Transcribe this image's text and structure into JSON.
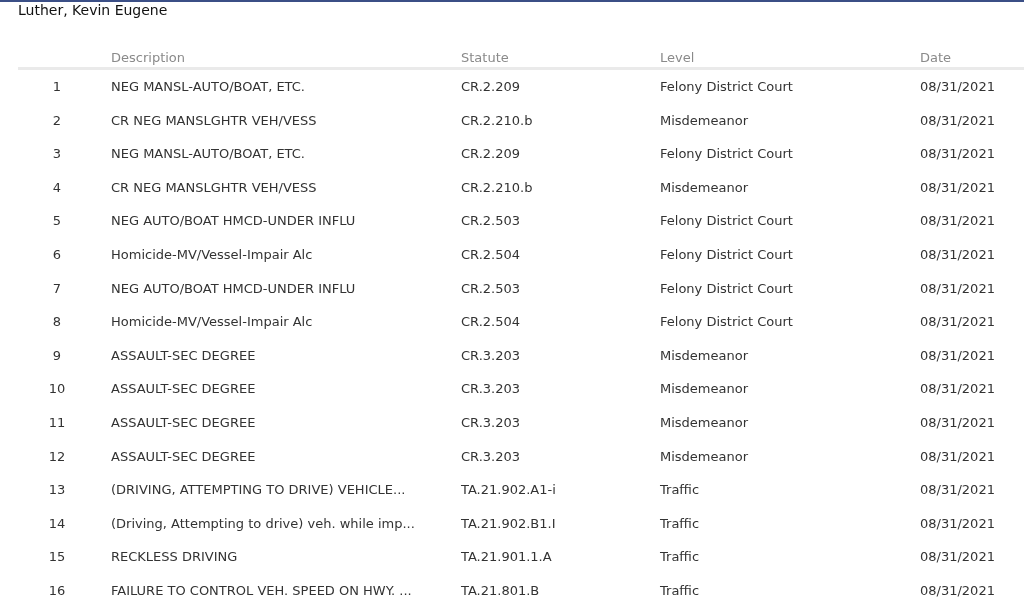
{
  "person_name": "Luther, Kevin Eugene",
  "table": {
    "columns": [
      "Description",
      "Statute",
      "Level",
      "Date"
    ],
    "rows": [
      {
        "number": "1",
        "description": "NEG MANSL-AUTO/BOAT, ETC.",
        "statute": "CR.2.209",
        "level": "Felony District Court",
        "date": "08/31/2021"
      },
      {
        "number": "2",
        "description": "CR NEG MANSLGHTR VEH/VESS",
        "statute": "CR.2.210.b",
        "level": "Misdemeanor",
        "date": "08/31/2021"
      },
      {
        "number": "3",
        "description": "NEG MANSL-AUTO/BOAT, ETC.",
        "statute": "CR.2.209",
        "level": "Felony District Court",
        "date": "08/31/2021"
      },
      {
        "number": "4",
        "description": "CR NEG MANSLGHTR VEH/VESS",
        "statute": "CR.2.210.b",
        "level": "Misdemeanor",
        "date": "08/31/2021"
      },
      {
        "number": "5",
        "description": "NEG AUTO/BOAT HMCD-UNDER INFLU",
        "statute": "CR.2.503",
        "level": "Felony District Court",
        "date": "08/31/2021"
      },
      {
        "number": "6",
        "description": "Homicide-MV/Vessel-Impair Alc",
        "statute": "CR.2.504",
        "level": "Felony District Court",
        "date": "08/31/2021"
      },
      {
        "number": "7",
        "description": "NEG AUTO/BOAT HMCD-UNDER INFLU",
        "statute": "CR.2.503",
        "level": "Felony District Court",
        "date": "08/31/2021"
      },
      {
        "number": "8",
        "description": "Homicide-MV/Vessel-Impair Alc",
        "statute": "CR.2.504",
        "level": "Felony District Court",
        "date": "08/31/2021"
      },
      {
        "number": "9",
        "description": "ASSAULT-SEC DEGREE",
        "statute": "CR.3.203",
        "level": "Misdemeanor",
        "date": "08/31/2021"
      },
      {
        "number": "10",
        "description": "ASSAULT-SEC DEGREE",
        "statute": "CR.3.203",
        "level": "Misdemeanor",
        "date": "08/31/2021"
      },
      {
        "number": "11",
        "description": "ASSAULT-SEC DEGREE",
        "statute": "CR.3.203",
        "level": "Misdemeanor",
        "date": "08/31/2021"
      },
      {
        "number": "12",
        "description": "ASSAULT-SEC DEGREE",
        "statute": "CR.3.203",
        "level": "Misdemeanor",
        "date": "08/31/2021"
      },
      {
        "number": "13",
        "description": "(DRIVING, ATTEMPTING TO DRIVE) VEHICLE...",
        "statute": "TA.21.902.A1-i",
        "level": "Traffic",
        "date": "08/31/2021"
      },
      {
        "number": "14",
        "description": "(Driving, Attempting to drive) veh. while imp...",
        "statute": "TA.21.902.B1.I",
        "level": "Traffic",
        "date": "08/31/2021"
      },
      {
        "number": "15",
        "description": "RECKLESS DRIVING",
        "statute": "TA.21.901.1.A",
        "level": "Traffic",
        "date": "08/31/2021"
      },
      {
        "number": "16",
        "description": "FAILURE TO CONTROL VEH. SPEED ON HWY. ...",
        "statute": "TA.21.801.B",
        "level": "Traffic",
        "date": "08/31/2021"
      }
    ]
  }
}
